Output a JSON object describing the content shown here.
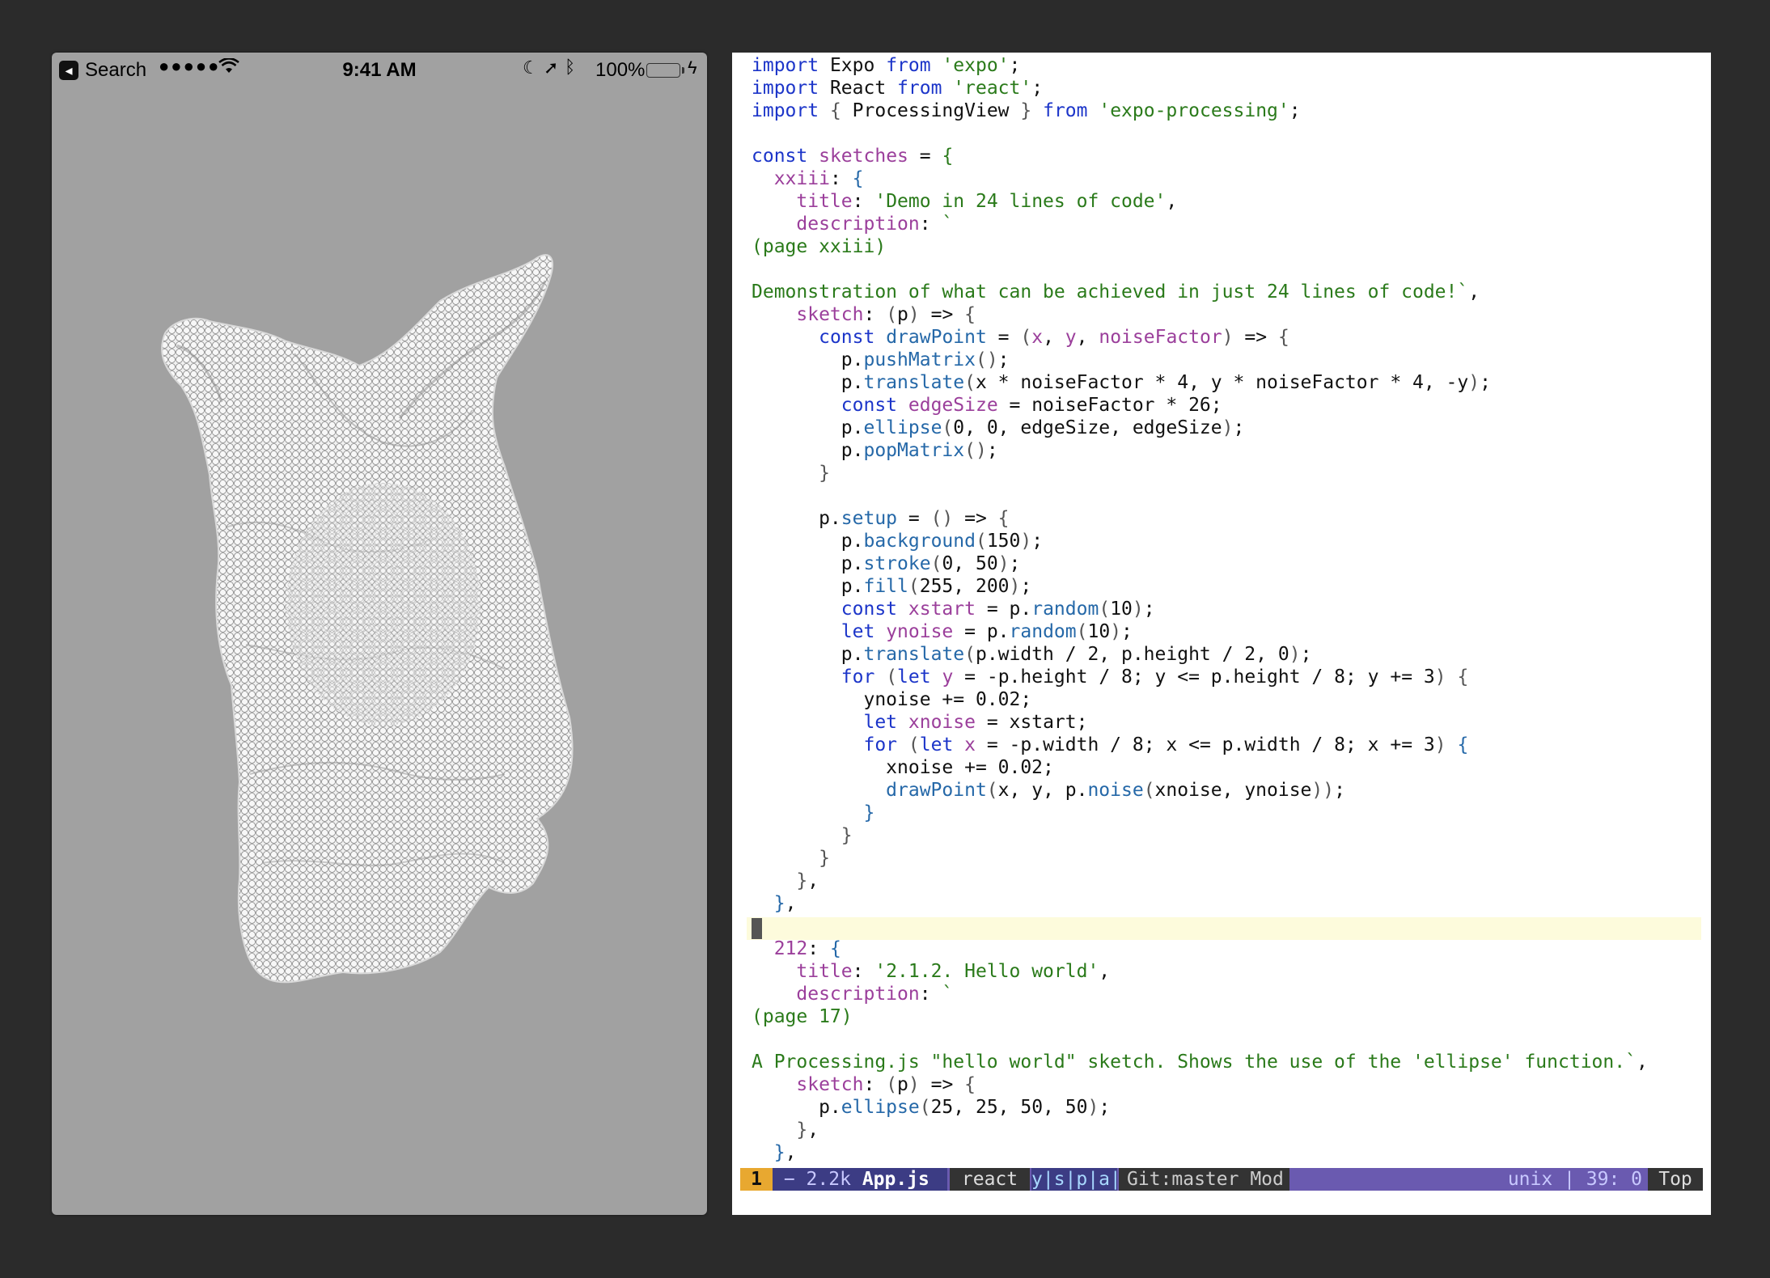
{
  "phone": {
    "status_bar": {
      "back_label": "Search",
      "signal": "●●●●●",
      "time": "9:41 AM",
      "battery_percent": "100%",
      "battery_level": 1.0
    },
    "canvas": {
      "background": "#a1a1a1",
      "description_icon": "noise-mesh-sculpture"
    }
  },
  "editor": {
    "code_lines": [
      [
        [
          "k",
          "import"
        ],
        [
          "n",
          " Expo "
        ],
        [
          "k",
          "from"
        ],
        [
          "n",
          " "
        ],
        [
          "s",
          "'expo'"
        ],
        [
          "n",
          ";"
        ]
      ],
      [
        [
          "k",
          "import"
        ],
        [
          "n",
          " React "
        ],
        [
          "k",
          "from"
        ],
        [
          "n",
          " "
        ],
        [
          "s",
          "'react'"
        ],
        [
          "n",
          ";"
        ]
      ],
      [
        [
          "k",
          "import"
        ],
        [
          "n",
          " "
        ],
        [
          "br",
          "{"
        ],
        [
          "n",
          " ProcessingView "
        ],
        [
          "br",
          "}"
        ],
        [
          "n",
          " "
        ],
        [
          "k",
          "from"
        ],
        [
          "n",
          " "
        ],
        [
          "s",
          "'expo-processing'"
        ],
        [
          "n",
          ";"
        ]
      ],
      [
        [
          "n",
          ""
        ]
      ],
      [
        [
          "k",
          "const"
        ],
        [
          "n",
          " "
        ],
        [
          "p",
          "sketches"
        ],
        [
          "n",
          " = "
        ],
        [
          "s",
          "{"
        ]
      ],
      [
        [
          "n",
          "  "
        ],
        [
          "p",
          "xxiii"
        ],
        [
          "n",
          ": "
        ],
        [
          "f",
          "{"
        ]
      ],
      [
        [
          "n",
          "    "
        ],
        [
          "p",
          "title"
        ],
        [
          "n",
          ": "
        ],
        [
          "s",
          "'Demo in 24 lines of code'"
        ],
        [
          "n",
          ","
        ]
      ],
      [
        [
          "n",
          "    "
        ],
        [
          "p",
          "description"
        ],
        [
          "n",
          ": "
        ],
        [
          "s",
          "`"
        ]
      ],
      [
        [
          "s",
          "(page xxiii)"
        ]
      ],
      [
        [
          "n",
          ""
        ]
      ],
      [
        [
          "s",
          "Demonstration of what can be achieved in just 24 lines of code!`"
        ],
        [
          "n",
          ","
        ]
      ],
      [
        [
          "n",
          "    "
        ],
        [
          "p",
          "sketch"
        ],
        [
          "n",
          ": "
        ],
        [
          "br",
          "("
        ],
        [
          "n",
          "p"
        ],
        [
          "br",
          ")"
        ],
        [
          "n",
          " => "
        ],
        [
          "br",
          "{"
        ]
      ],
      [
        [
          "n",
          "      "
        ],
        [
          "k",
          "const"
        ],
        [
          "n",
          " "
        ],
        [
          "f",
          "drawPoint"
        ],
        [
          "n",
          " = "
        ],
        [
          "br",
          "("
        ],
        [
          "p",
          "x"
        ],
        [
          "n",
          ", "
        ],
        [
          "p",
          "y"
        ],
        [
          "n",
          ", "
        ],
        [
          "p",
          "noiseFactor"
        ],
        [
          "br",
          ")"
        ],
        [
          "n",
          " => "
        ],
        [
          "br",
          "{"
        ]
      ],
      [
        [
          "n",
          "        p."
        ],
        [
          "f",
          "pushMatrix"
        ],
        [
          "br",
          "()"
        ],
        [
          "n",
          ";"
        ]
      ],
      [
        [
          "n",
          "        p."
        ],
        [
          "f",
          "translate"
        ],
        [
          "br",
          "("
        ],
        [
          "n",
          "x * noiseFactor * 4, y * noiseFactor * 4, -y"
        ],
        [
          "br",
          ")"
        ],
        [
          "n",
          ";"
        ]
      ],
      [
        [
          "n",
          "        "
        ],
        [
          "k",
          "const"
        ],
        [
          "n",
          " "
        ],
        [
          "p",
          "edgeSize"
        ],
        [
          "n",
          " = noiseFactor * 26;"
        ]
      ],
      [
        [
          "n",
          "        p."
        ],
        [
          "f",
          "ellipse"
        ],
        [
          "br",
          "("
        ],
        [
          "n",
          "0, 0, edgeSize, edgeSize"
        ],
        [
          "br",
          ")"
        ],
        [
          "n",
          ";"
        ]
      ],
      [
        [
          "n",
          "        p."
        ],
        [
          "f",
          "popMatrix"
        ],
        [
          "br",
          "()"
        ],
        [
          "n",
          ";"
        ]
      ],
      [
        [
          "n",
          "      "
        ],
        [
          "br",
          "}"
        ]
      ],
      [
        [
          "n",
          ""
        ]
      ],
      [
        [
          "n",
          "      p."
        ],
        [
          "f",
          "setup"
        ],
        [
          "n",
          " = "
        ],
        [
          "br",
          "()"
        ],
        [
          "n",
          " => "
        ],
        [
          "br",
          "{"
        ]
      ],
      [
        [
          "n",
          "        p."
        ],
        [
          "f",
          "background"
        ],
        [
          "br",
          "("
        ],
        [
          "n",
          "150"
        ],
        [
          "br",
          ")"
        ],
        [
          "n",
          ";"
        ]
      ],
      [
        [
          "n",
          "        p."
        ],
        [
          "f",
          "stroke"
        ],
        [
          "br",
          "("
        ],
        [
          "n",
          "0, 50"
        ],
        [
          "br",
          ")"
        ],
        [
          "n",
          ";"
        ]
      ],
      [
        [
          "n",
          "        p."
        ],
        [
          "f",
          "fill"
        ],
        [
          "br",
          "("
        ],
        [
          "n",
          "255, 200"
        ],
        [
          "br",
          ")"
        ],
        [
          "n",
          ";"
        ]
      ],
      [
        [
          "n",
          "        "
        ],
        [
          "k",
          "const"
        ],
        [
          "n",
          " "
        ],
        [
          "p",
          "xstart"
        ],
        [
          "n",
          " = p."
        ],
        [
          "f",
          "random"
        ],
        [
          "br",
          "("
        ],
        [
          "n",
          "10"
        ],
        [
          "br",
          ")"
        ],
        [
          "n",
          ";"
        ]
      ],
      [
        [
          "n",
          "        "
        ],
        [
          "k",
          "let"
        ],
        [
          "n",
          " "
        ],
        [
          "p",
          "ynoise"
        ],
        [
          "n",
          " = p."
        ],
        [
          "f",
          "random"
        ],
        [
          "br",
          "("
        ],
        [
          "n",
          "10"
        ],
        [
          "br",
          ")"
        ],
        [
          "n",
          ";"
        ]
      ],
      [
        [
          "n",
          "        p."
        ],
        [
          "f",
          "translate"
        ],
        [
          "br",
          "("
        ],
        [
          "n",
          "p.width / 2, p.height / 2, 0"
        ],
        [
          "br",
          ")"
        ],
        [
          "n",
          ";"
        ]
      ],
      [
        [
          "n",
          "        "
        ],
        [
          "k",
          "for"
        ],
        [
          "n",
          " "
        ],
        [
          "br",
          "("
        ],
        [
          "k",
          "let"
        ],
        [
          "n",
          " "
        ],
        [
          "p",
          "y"
        ],
        [
          "n",
          " = -p.height / 8; y <= p.height / 8; y += 3"
        ],
        [
          "br",
          ")"
        ],
        [
          "n",
          " "
        ],
        [
          "br",
          "{"
        ]
      ],
      [
        [
          "n",
          "          ynoise += 0.02;"
        ]
      ],
      [
        [
          "n",
          "          "
        ],
        [
          "k",
          "let"
        ],
        [
          "n",
          " "
        ],
        [
          "p",
          "xnoise"
        ],
        [
          "n",
          " = xstart;"
        ]
      ],
      [
        [
          "n",
          "          "
        ],
        [
          "k",
          "for"
        ],
        [
          "n",
          " "
        ],
        [
          "br",
          "("
        ],
        [
          "k",
          "let"
        ],
        [
          "n",
          " "
        ],
        [
          "p",
          "x"
        ],
        [
          "n",
          " = -p.width / 8; x <= p.width / 8; x += 3"
        ],
        [
          "br",
          ")"
        ],
        [
          "n",
          " "
        ],
        [
          "f",
          "{"
        ]
      ],
      [
        [
          "n",
          "            xnoise += 0.02;"
        ]
      ],
      [
        [
          "n",
          "            "
        ],
        [
          "f",
          "drawPoint"
        ],
        [
          "br",
          "("
        ],
        [
          "n",
          "x, y, p."
        ],
        [
          "f",
          "noise"
        ],
        [
          "br",
          "("
        ],
        [
          "n",
          "xnoise, ynoise"
        ],
        [
          "br",
          "))"
        ],
        [
          "n",
          ";"
        ]
      ],
      [
        [
          "n",
          "          "
        ],
        [
          "f",
          "}"
        ]
      ],
      [
        [
          "n",
          "        "
        ],
        [
          "br",
          "}"
        ]
      ],
      [
        [
          "n",
          "      "
        ],
        [
          "br",
          "}"
        ]
      ],
      [
        [
          "n",
          "    "
        ],
        [
          "br",
          "}"
        ],
        [
          "n",
          ","
        ]
      ],
      [
        [
          "n",
          "  "
        ],
        [
          "f",
          "}"
        ],
        [
          "n",
          ","
        ]
      ],
      [
        [
          "n",
          ""
        ]
      ],
      [
        [
          "n",
          "  "
        ],
        [
          "p",
          "212"
        ],
        [
          "n",
          ": "
        ],
        [
          "f",
          "{"
        ]
      ],
      [
        [
          "n",
          "    "
        ],
        [
          "p",
          "title"
        ],
        [
          "n",
          ": "
        ],
        [
          "s",
          "'2.1.2. Hello world'"
        ],
        [
          "n",
          ","
        ]
      ],
      [
        [
          "n",
          "    "
        ],
        [
          "p",
          "description"
        ],
        [
          "n",
          ": "
        ],
        [
          "s",
          "`"
        ]
      ],
      [
        [
          "s",
          "(page 17)"
        ]
      ],
      [
        [
          "n",
          ""
        ]
      ],
      [
        [
          "s",
          "A Processing.js \"hello world\" sketch. Shows the use of the 'ellipse' function.`"
        ],
        [
          "n",
          ","
        ]
      ],
      [
        [
          "n",
          "    "
        ],
        [
          "p",
          "sketch"
        ],
        [
          "n",
          ": "
        ],
        [
          "br",
          "("
        ],
        [
          "n",
          "p"
        ],
        [
          "br",
          ")"
        ],
        [
          "n",
          " => "
        ],
        [
          "br",
          "{"
        ]
      ],
      [
        [
          "n",
          "      p."
        ],
        [
          "f",
          "ellipse"
        ],
        [
          "br",
          "("
        ],
        [
          "n",
          "25, 25, 50, 50"
        ],
        [
          "br",
          ")"
        ],
        [
          "n",
          ";"
        ]
      ],
      [
        [
          "n",
          "    "
        ],
        [
          "br",
          "}"
        ],
        [
          "n",
          ","
        ]
      ],
      [
        [
          "n",
          "  "
        ],
        [
          "f",
          "}"
        ],
        [
          "n",
          ","
        ]
      ]
    ],
    "cursor_line": 39,
    "modeline": {
      "window_number": "1",
      "file_size": "− 2.2k",
      "file_name": "App.js",
      "major_mode": "react",
      "minor_modes": "y|s|p|a|K",
      "git": "Git:master Mod",
      "position": "unix | 39: 0",
      "scroll": "Top"
    }
  },
  "colors": {
    "page_bg": "#2b2b2b",
    "phone_bg": "#a1a1a1",
    "keyword": "#1c35c9",
    "string": "#2a7a1a",
    "property": "#9b3f9b",
    "modeline_bg": "#6a5ab0",
    "modeline_accent": "#e8a830"
  }
}
